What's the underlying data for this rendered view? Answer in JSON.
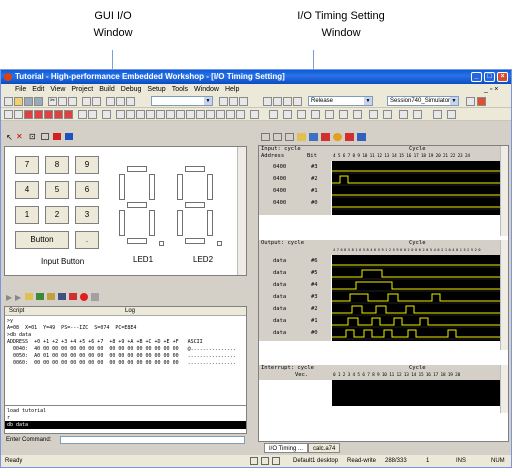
{
  "callouts": {
    "gui_io": [
      "GUI I/O",
      "Window"
    ],
    "io_timing": [
      "I/O Timing Setting",
      "Window"
    ]
  },
  "window": {
    "title": "Tutorial - High-performance Embedded Workshop - [I/O Timing Setting]"
  },
  "menu": [
    "File",
    "Edit",
    "View",
    "Project",
    "Build",
    "Debug",
    "Setup",
    "Tools",
    "Window",
    "Help"
  ],
  "toolbar": {
    "config_combo": "Release",
    "session_combo": "Session740_Simulator"
  },
  "gui_io": {
    "keys": [
      "7",
      "8",
      "9",
      "4",
      "5",
      "6",
      "1",
      "2",
      "3",
      "Button",
      "."
    ],
    "input_label": "Input Button",
    "led1": "LED1",
    "led2": "LED2"
  },
  "script": {
    "header_script": "Script",
    "header_log": "Log",
    "lines": [
      ">y",
      "A=08  X=01  Y=49  PS=---IZC  S=074  PC=E8E4",
      ">db data",
      "ADDRESS  +0 +1 +2 +3 +4 +5 +6 +7  +8 +9 +A +B +C +D +E +F   ASCII",
      "  0040:  40 00 00 00 00 00 00 00  00 00 00 00 00 00 00 00   @...............",
      "  0050:  A0 01 00 00 00 00 00 00  00 00 00 00 00 00 00 00   ................",
      "  0060:  00 00 00 00 00 00 00 00  00 00 00 00 00 00 00 00   ................"
    ],
    "history": [
      "load tutorial",
      "r"
    ],
    "selected": "db data",
    "enter_label": "Enter Command:"
  },
  "timing": {
    "input": {
      "title": "Input: cycle",
      "cycle": "Cycle",
      "col_address": "Address",
      "col_bit": "Bit",
      "cycles": "4 5 6 7 8 9 10 11 12 13 14 15 16 17 18 19 20 21 22 23 24",
      "rows": [
        {
          "addr": "0400",
          "bit": "#3"
        },
        {
          "addr": "0400",
          "bit": "#2"
        },
        {
          "addr": "0400",
          "bit": "#1"
        },
        {
          "addr": "0400",
          "bit": "#0"
        }
      ]
    },
    "output": {
      "title": "Output: cycle",
      "cycle": "Cycle",
      "cycles": "4 7 6 8 5 8 1 6 5 8 4 6 5 9 1 2 5 9 6 0 2 0 0 6 2 0 5 4 0 2 1 0 4 0 1 5 2 5 2 0",
      "rows": [
        {
          "addr": "data",
          "bit": "#6"
        },
        {
          "addr": "data",
          "bit": "#5"
        },
        {
          "addr": "data",
          "bit": "#4"
        },
        {
          "addr": "data",
          "bit": "#3"
        },
        {
          "addr": "data",
          "bit": "#2"
        },
        {
          "addr": "data",
          "bit": "#1"
        },
        {
          "addr": "data",
          "bit": "#0"
        }
      ]
    },
    "interrupt": {
      "title": "Interrupt: cycle",
      "cycle": "Cycle",
      "vec": "Vec.",
      "cycles": "0 1 2 3 4 5 6 7 8 9 10 11 12 13 14 15 16 17 18 19 20"
    },
    "tabs": [
      "I/O Timing ...",
      "calc.a74"
    ]
  },
  "statusbar": {
    "ready": "Ready",
    "desktop": "Default1 desktop",
    "mode": "Read-write",
    "pos": "288/333",
    "col": "1",
    "ins": "INS",
    "num": "NUM"
  },
  "colors": {
    "title_blue": "#0a5bd8",
    "wave_yellow": "#f0f000",
    "grid_black": "#000000",
    "grid_lines": "#404040"
  }
}
